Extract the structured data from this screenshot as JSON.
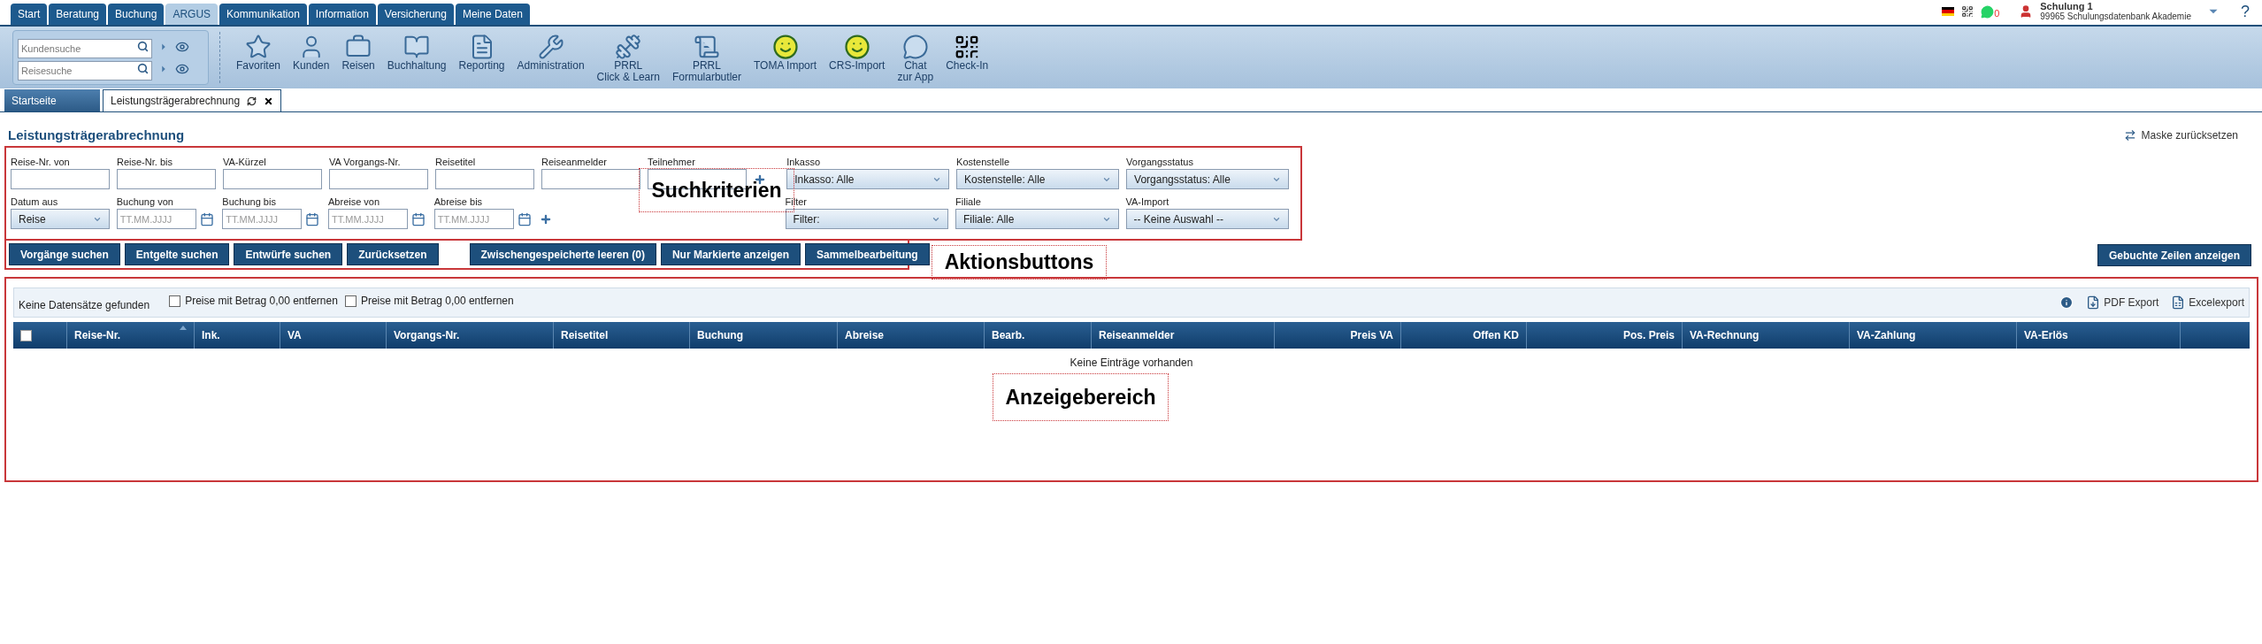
{
  "nav_tabs": [
    {
      "label": "Start",
      "selected": false
    },
    {
      "label": "Beratung",
      "selected": false
    },
    {
      "label": "Buchung",
      "selected": false
    },
    {
      "label": "ARGUS",
      "selected": true
    },
    {
      "label": "Kommunikation",
      "selected": false
    },
    {
      "label": "Information",
      "selected": false
    },
    {
      "label": "Versicherung",
      "selected": false
    },
    {
      "label": "Meine Daten",
      "selected": false
    }
  ],
  "user": {
    "name": "Schulung 1",
    "org": "99965 Schulungsdatenbank Akademie",
    "message_count": "0",
    "help": "?"
  },
  "quick_search": [
    {
      "placeholder": "Kundensuche"
    },
    {
      "placeholder": "Reisesuche"
    }
  ],
  "toolbar": [
    {
      "kind": "star",
      "lines": [
        "Favoriten"
      ]
    },
    {
      "kind": "person",
      "lines": [
        "Kunden"
      ]
    },
    {
      "kind": "suitcase",
      "lines": [
        "Reisen"
      ]
    },
    {
      "kind": "book",
      "lines": [
        "Buchhaltung"
      ]
    },
    {
      "kind": "report",
      "lines": [
        "Reporting"
      ]
    },
    {
      "kind": "tools",
      "lines": [
        "Administration"
      ]
    },
    {
      "kind": "dumbbell",
      "lines": [
        "PRRL",
        "Click & Learn"
      ]
    },
    {
      "kind": "paragraph",
      "lines": [
        "PRRL",
        "Formularbutler"
      ]
    },
    {
      "kind": "smiley",
      "lines": [
        "TOMA Import"
      ]
    },
    {
      "kind": "smiley",
      "lines": [
        "CRS-Import"
      ]
    },
    {
      "kind": "chat",
      "lines": [
        "Chat",
        "zur App"
      ]
    },
    {
      "kind": "qr",
      "lines": [
        "Check-In"
      ]
    }
  ],
  "page_tabs": [
    {
      "label": "Startseite",
      "selected": false
    },
    {
      "label": "Leistungsträgerabrechnung",
      "selected": true
    }
  ],
  "title": "Leistungsträgerabrechnung",
  "reset_mask": "Maske zurücksetzen",
  "filters": [
    [
      {
        "kind": "text",
        "label": "Reise-Nr. von"
      },
      {
        "kind": "text",
        "label": "Reise-Nr. bis"
      },
      {
        "kind": "text",
        "label": "VA-Kürzel"
      },
      {
        "kind": "text",
        "label": "VA Vorgangs-Nr."
      },
      {
        "kind": "text",
        "label": "Reisetitel"
      },
      {
        "kind": "text",
        "label": "Reiseanmelder"
      },
      {
        "kind": "text_plus",
        "label": "Teilnehmer"
      },
      {
        "kind": "select",
        "label": "Inkasso",
        "value": "Inkasso: Alle"
      },
      {
        "kind": "select",
        "label": "Kostenstelle",
        "value": "Kostenstelle: Alle"
      },
      {
        "kind": "select",
        "label": "Vorgangsstatus",
        "value": "Vorgangsstatus: Alle"
      }
    ],
    [
      {
        "kind": "select_small",
        "label": "Datum aus",
        "value": "Reise"
      },
      {
        "kind": "date",
        "label": "Buchung von",
        "placeholder": "TT.MM.JJJJ"
      },
      {
        "kind": "date",
        "label": "Buchung bis",
        "placeholder": "TT.MM.JJJJ"
      },
      {
        "kind": "date",
        "label": "Abreise von",
        "placeholder": "TT.MM.JJJJ"
      },
      {
        "kind": "date",
        "label": "Abreise bis",
        "placeholder": "TT.MM.JJJJ"
      },
      {
        "kind": "plus"
      },
      {
        "kind": "gap"
      },
      {
        "kind": "select",
        "label": "Filter",
        "value": "Filter:"
      },
      {
        "kind": "select",
        "label": "Filiale",
        "value": "Filiale: Alle"
      },
      {
        "kind": "select",
        "label": "VA-Import",
        "value": "-- Keine Auswahl --"
      }
    ]
  ],
  "actions": [
    "Vorgänge suchen",
    "Entgelte suchen",
    "Entwürfe suchen",
    "Zurücksetzen",
    "Zwischengespeicherte leeren (0)",
    "Nur Markierte anzeigen",
    "Sammelbearbeitung"
  ],
  "right_action": "Gebuchte Zeilen anzeigen",
  "annotations": [
    "Suchkriterien",
    "Aktionsbuttons",
    "Anzeigebereich"
  ],
  "results": {
    "status": "Keine Datensätze gefunden",
    "options": [
      {
        "label": "Preise mit Betrag 0,00 entfernen",
        "checked": false
      },
      {
        "label": "Preise mit Betrag 0,00 entfernen",
        "checked": false
      }
    ],
    "exports": [
      "PDF Export",
      "Excelexport"
    ],
    "select_all": {
      "checked": false
    },
    "columns": [
      {
        "label": "Reise-Nr.",
        "sorted": true
      },
      {
        "label": "Ink.",
        "sorted": false
      },
      {
        "label": "VA",
        "sorted": false
      },
      {
        "label": "Vorgangs-Nr.",
        "sorted": false
      },
      {
        "label": "Reisetitel",
        "sorted": false
      },
      {
        "label": "Buchung",
        "sorted": false
      },
      {
        "label": "Abreise",
        "sorted": false
      },
      {
        "label": "Bearb.",
        "sorted": false
      },
      {
        "label": "Reiseanmelder",
        "sorted": false
      },
      {
        "label": "Preis VA",
        "sorted": false
      },
      {
        "label": "Offen KD",
        "sorted": false
      },
      {
        "label": "Pos. Preis",
        "sorted": false
      },
      {
        "label": "VA-Rechnung",
        "sorted": false
      },
      {
        "label": "VA-Zahlung",
        "sorted": false
      },
      {
        "label": "VA-Erlös",
        "sorted": false
      }
    ],
    "empty": "Keine Einträge vorhanden"
  }
}
